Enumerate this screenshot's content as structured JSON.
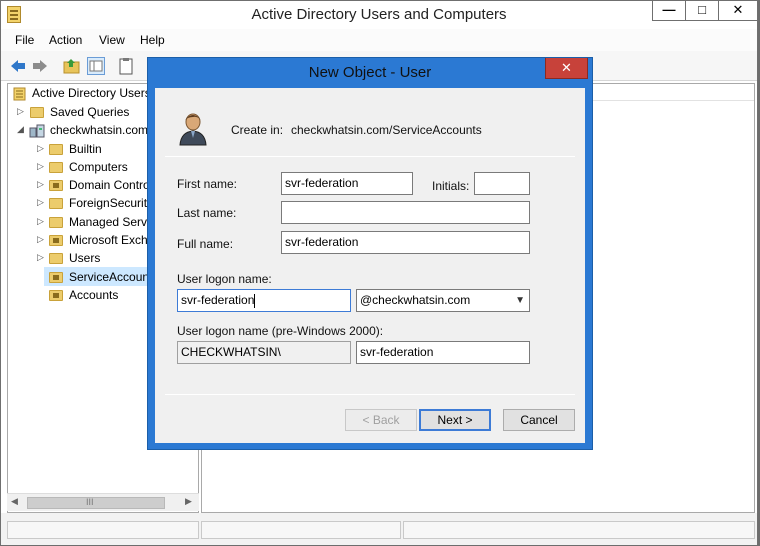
{
  "window": {
    "title": "Active Directory Users and Computers",
    "minimize_glyph": "—",
    "maximize_glyph": "□",
    "close_glyph": "✕"
  },
  "menu": [
    "File",
    "Action",
    "View",
    "Help"
  ],
  "tree": {
    "root": "Active Directory Users",
    "items": [
      {
        "label": "Saved Queries",
        "level": 1,
        "arrow": "▷",
        "icon": "folder-icon"
      },
      {
        "label": "checkwhatsin.com",
        "level": 1,
        "arrow": "◢",
        "icon": "domain-icon"
      },
      {
        "label": "Builtin",
        "level": 2,
        "arrow": "▷",
        "icon": "folder-icon"
      },
      {
        "label": "Computers",
        "level": 2,
        "arrow": "▷",
        "icon": "folder-icon"
      },
      {
        "label": "Domain Contro",
        "level": 2,
        "arrow": "▷",
        "icon": "ou-folder-icon"
      },
      {
        "label": "ForeignSecurity",
        "level": 2,
        "arrow": "▷",
        "icon": "folder-icon"
      },
      {
        "label": "Managed Servic",
        "level": 2,
        "arrow": "▷",
        "icon": "folder-icon"
      },
      {
        "label": "Microsoft Excha",
        "level": 2,
        "arrow": "▷",
        "icon": "ou-folder-icon"
      },
      {
        "label": "Users",
        "level": 2,
        "arrow": "▷",
        "icon": "folder-icon"
      },
      {
        "label": "ServiceAccount",
        "level": 2,
        "arrow": "",
        "icon": "ou-folder-icon",
        "selected": true
      },
      {
        "label": "Accounts",
        "level": 2,
        "arrow": "",
        "icon": "ou-folder-icon"
      }
    ]
  },
  "scrollbar": {
    "left": "◀",
    "grip": "III",
    "right": "▶"
  },
  "dialog": {
    "title": "New Object - User",
    "close_glyph": "✕",
    "create_in_label": "Create in:",
    "create_in_value": "checkwhatsin.com/ServiceAccounts",
    "first_name_label": "First name:",
    "first_name_value": "svr-federation",
    "initials_label": "Initials:",
    "initials_value": "",
    "last_name_label": "Last name:",
    "last_name_value": "",
    "full_name_label": "Full name:",
    "full_name_value": "svr-federation",
    "logon_name_label": "User logon name:",
    "logon_name_value": "svr-federation",
    "domain_suffix": "@checkwhatsin.com",
    "combo_arrow": "▼",
    "pre2000_label": "User logon name (pre-Windows 2000):",
    "pre2000_domain": "CHECKWHATSIN\\",
    "pre2000_user": "svr-federation",
    "back_label": "< Back",
    "next_label": "Next >",
    "cancel_label": "Cancel"
  }
}
